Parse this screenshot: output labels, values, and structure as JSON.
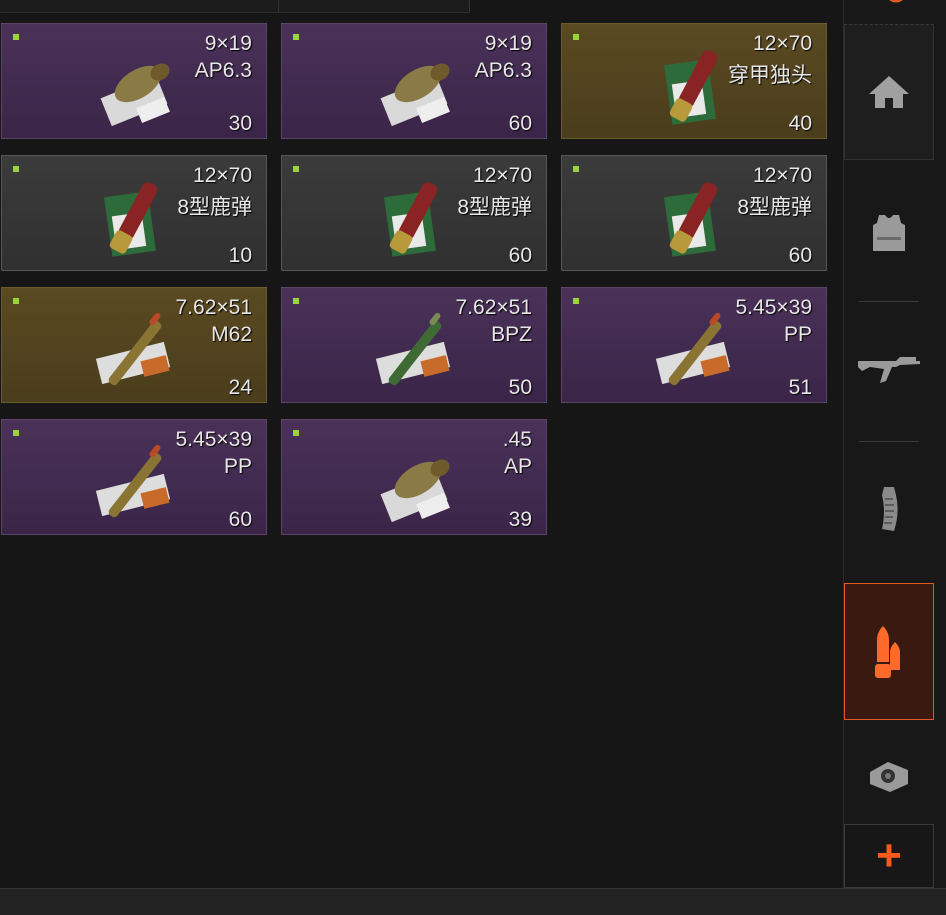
{
  "items": [
    {
      "caliber": "9×19",
      "type": "AP6.3",
      "count": "30",
      "rarity": "purple",
      "art": "pistol-round-icon"
    },
    {
      "caliber": "9×19",
      "type": "AP6.3",
      "count": "60",
      "rarity": "purple",
      "art": "pistol-round-icon"
    },
    {
      "caliber": "12×70",
      "type": "穿甲独头",
      "count": "40",
      "rarity": "gold",
      "art": "shotgun-shell-icon"
    },
    {
      "caliber": "12×70",
      "type": "8型鹿弹",
      "count": "10",
      "rarity": "gray",
      "art": "shotgun-shell-icon"
    },
    {
      "caliber": "12×70",
      "type": "8型鹿弹",
      "count": "60",
      "rarity": "gray",
      "art": "shotgun-shell-icon"
    },
    {
      "caliber": "12×70",
      "type": "8型鹿弹",
      "count": "60",
      "rarity": "gray",
      "art": "shotgun-shell-icon"
    },
    {
      "caliber": "7.62×51",
      "type": "M62",
      "count": "24",
      "rarity": "gold",
      "art": "rifle-round-icon"
    },
    {
      "caliber": "7.62×51",
      "type": "BPZ",
      "count": "50",
      "rarity": "purple",
      "art": "rifle-round-green-icon"
    },
    {
      "caliber": "5.45×39",
      "type": "PP",
      "count": "51",
      "rarity": "purple",
      "art": "rifle-round-icon"
    },
    {
      "caliber": "5.45×39",
      "type": "PP",
      "count": "60",
      "rarity": "purple",
      "art": "rifle-round-icon"
    },
    {
      "caliber": ".45",
      "type": "AP",
      "count": "39",
      "rarity": "purple",
      "art": "pistol-round-icon"
    }
  ],
  "sidebar": {
    "buttons": [
      "home-icon",
      "armor-vest-icon",
      "rifle-icon",
      "magazine-icon",
      "ammo-icon",
      "sight-icon"
    ],
    "active": "ammo-icon",
    "plus_label": "+"
  },
  "colors": {
    "accent": "#e05a22",
    "purple": "#4a3158",
    "gold": "#5a4a22",
    "gray": "#3b3b3b",
    "marker": "#9ad33c"
  }
}
